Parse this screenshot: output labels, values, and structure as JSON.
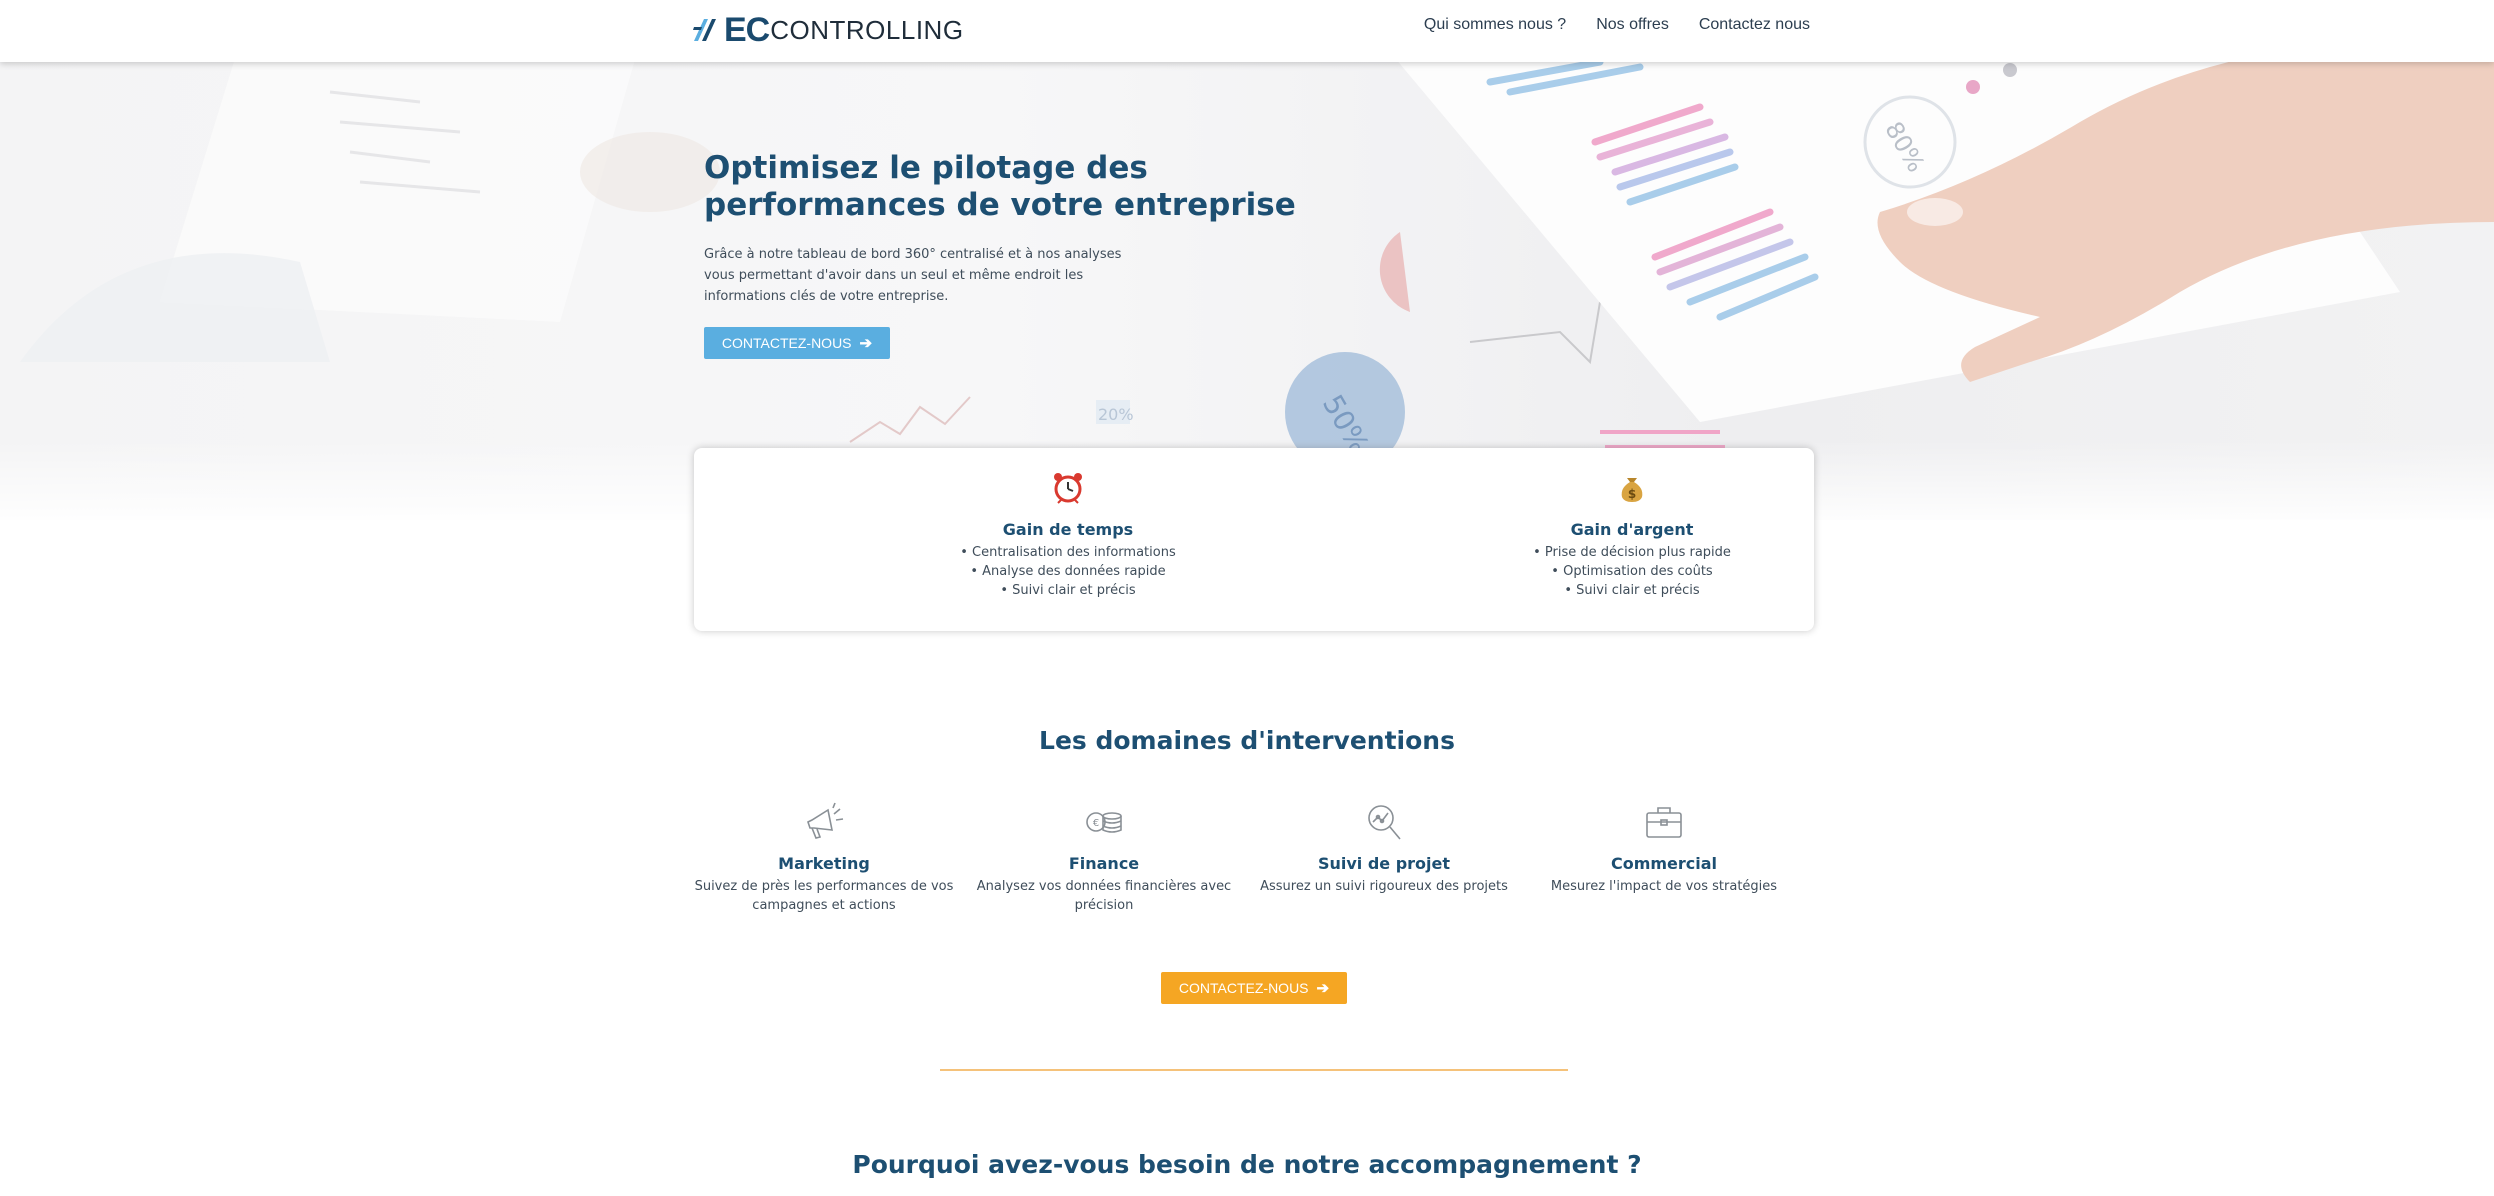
{
  "header": {
    "logo_ec": "EC",
    "logo_controlling": "CONTROLLING",
    "nav": [
      "Qui sommes nous ?",
      "Nos offres",
      "Contactez nous"
    ]
  },
  "hero": {
    "title": "Optimisez le pilotage des performances de votre entreprise",
    "text": "Grâce à notre tableau de bord 360° centralisé et à nos analyses vous permettant d'avoir dans un seul et même endroit les informations clés de votre entreprise.",
    "cta_label": "CONTACTEZ-NOUS",
    "cta_color": "#5aaee0",
    "image_labels": [
      "80%",
      "50%"
    ]
  },
  "benefits": [
    {
      "icon": "alarm-clock-icon",
      "title": "Gain de temps",
      "items": [
        "• Centralisation des informations",
        "• Analyse des données rapide",
        "• Suivi clair et précis"
      ]
    },
    {
      "icon": "money-bag-icon",
      "title": "Gain d'argent",
      "items": [
        "• Prise de décision plus rapide",
        "• Optimisation des coûts",
        "• Suivi clair et précis"
      ]
    }
  ],
  "domains_section": {
    "title": "Les domaines d'interventions",
    "items": [
      {
        "icon": "megaphone-icon",
        "title": "Marketing",
        "desc": "Suivez de près les performances de vos campagnes et actions"
      },
      {
        "icon": "coins-icon",
        "title": "Finance",
        "desc": "Analysez vos données financières avec précision"
      },
      {
        "icon": "magnifier-chart-icon",
        "title": "Suivi de projet",
        "desc": "Assurez un suivi rigoureux des projets"
      },
      {
        "icon": "briefcase-icon",
        "title": "Commercial",
        "desc": "Mesurez l'impact de vos stratégies"
      }
    ],
    "cta_label": "CONTACTEZ-NOUS",
    "cta_color": "#f5a623"
  },
  "why_section": {
    "title": "Pourquoi avez-vous besoin de notre accompagnement ?"
  }
}
